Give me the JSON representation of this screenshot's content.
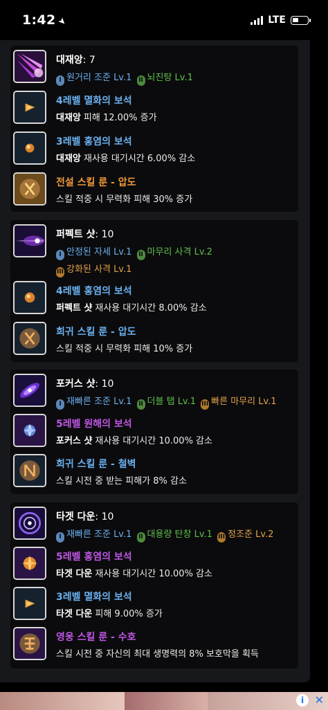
{
  "status_bar": {
    "time": "1:42",
    "network": "LTE"
  },
  "skills": [
    {
      "name": "대재앙",
      "level": "7",
      "tripods": [
        {
          "tier": "I",
          "label": "원거리 조준 Lv.1"
        },
        {
          "tier": "II",
          "label": "뇌진탕 Lv.1"
        }
      ],
      "gems": [
        {
          "title": "4레벨 멸화의 보석",
          "skill": "대재앙",
          "effect": "피해 12.00% 증가"
        },
        {
          "title": "3레벨 홍염의 보석",
          "skill": "대재앙",
          "effect": "재사용 대기시간 6.00% 감소"
        }
      ],
      "rune": {
        "title": "전설 스킬 룬 - 압도",
        "effect": "스킬 적중 시 무력화 피해 30% 증가"
      }
    },
    {
      "name": "퍼펙트 샷",
      "level": "10",
      "tripods": [
        {
          "tier": "I",
          "label": "안정된 자세 Lv.1"
        },
        {
          "tier": "II",
          "label": "마무리 사격 Lv.2"
        },
        {
          "tier": "III",
          "label": "강화된 사격 Lv.1"
        }
      ],
      "gems": [
        {
          "title": "4레벨 홍염의 보석",
          "skill": "퍼펙트 샷",
          "effect": "재사용 대기시간 8.00% 감소"
        }
      ],
      "rune": {
        "title": "희귀 스킬 룬 - 압도",
        "effect": "스킬 적중 시 무력화 피해 10% 증가"
      }
    },
    {
      "name": "포커스 샷",
      "level": "10",
      "tripods": [
        {
          "tier": "I",
          "label": "재빠른 조준 Lv.1"
        },
        {
          "tier": "II",
          "label": "더블 탭 Lv.1"
        },
        {
          "tier": "III",
          "label": "빠른 마무리 Lv.1"
        }
      ],
      "gems": [
        {
          "title": "5레벨 원해의 보석",
          "skill": "포커스 샷",
          "effect": "재사용 대기시간 10.00% 감소"
        }
      ],
      "rune": {
        "title": "희귀 스킬 룬 - 철벽",
        "effect": "스킬 시전 중 받는 피해가 8% 감소"
      }
    },
    {
      "name": "타겟 다운",
      "level": "10",
      "tripods": [
        {
          "tier": "I",
          "label": "재빠른 조준 Lv.1"
        },
        {
          "tier": "II",
          "label": "대용량 탄창 Lv.1"
        },
        {
          "tier": "III",
          "label": "정조준 Lv.2"
        }
      ],
      "gems": [
        {
          "title": "5레벨 홍염의 보석",
          "skill": "타겟 다운",
          "effect": "재사용 대기시간 10.00% 감소"
        },
        {
          "title": "3레벨 멸화의 보석",
          "skill": "타겟 다운",
          "effect": "피해 9.00% 증가"
        }
      ],
      "rune": {
        "title": "영웅 스킬 룬 - 수호",
        "effect": "스킬 시전 중 자신의 최대 생명력의 8% 보호막을 획득"
      }
    }
  ],
  "colors": {
    "panel": "#17181b",
    "card": "#0b0b0d",
    "tripod_1": "#6ab0ef",
    "tripod_2": "#5fbf4a",
    "tripod_3": "#e2a24a",
    "gem_blue": "#6ab0ef",
    "gem_purple": "#c056e6",
    "rune_legend": "#ef9a3a"
  },
  "ad": {
    "info_icon": "i",
    "close_icon": "✕"
  }
}
